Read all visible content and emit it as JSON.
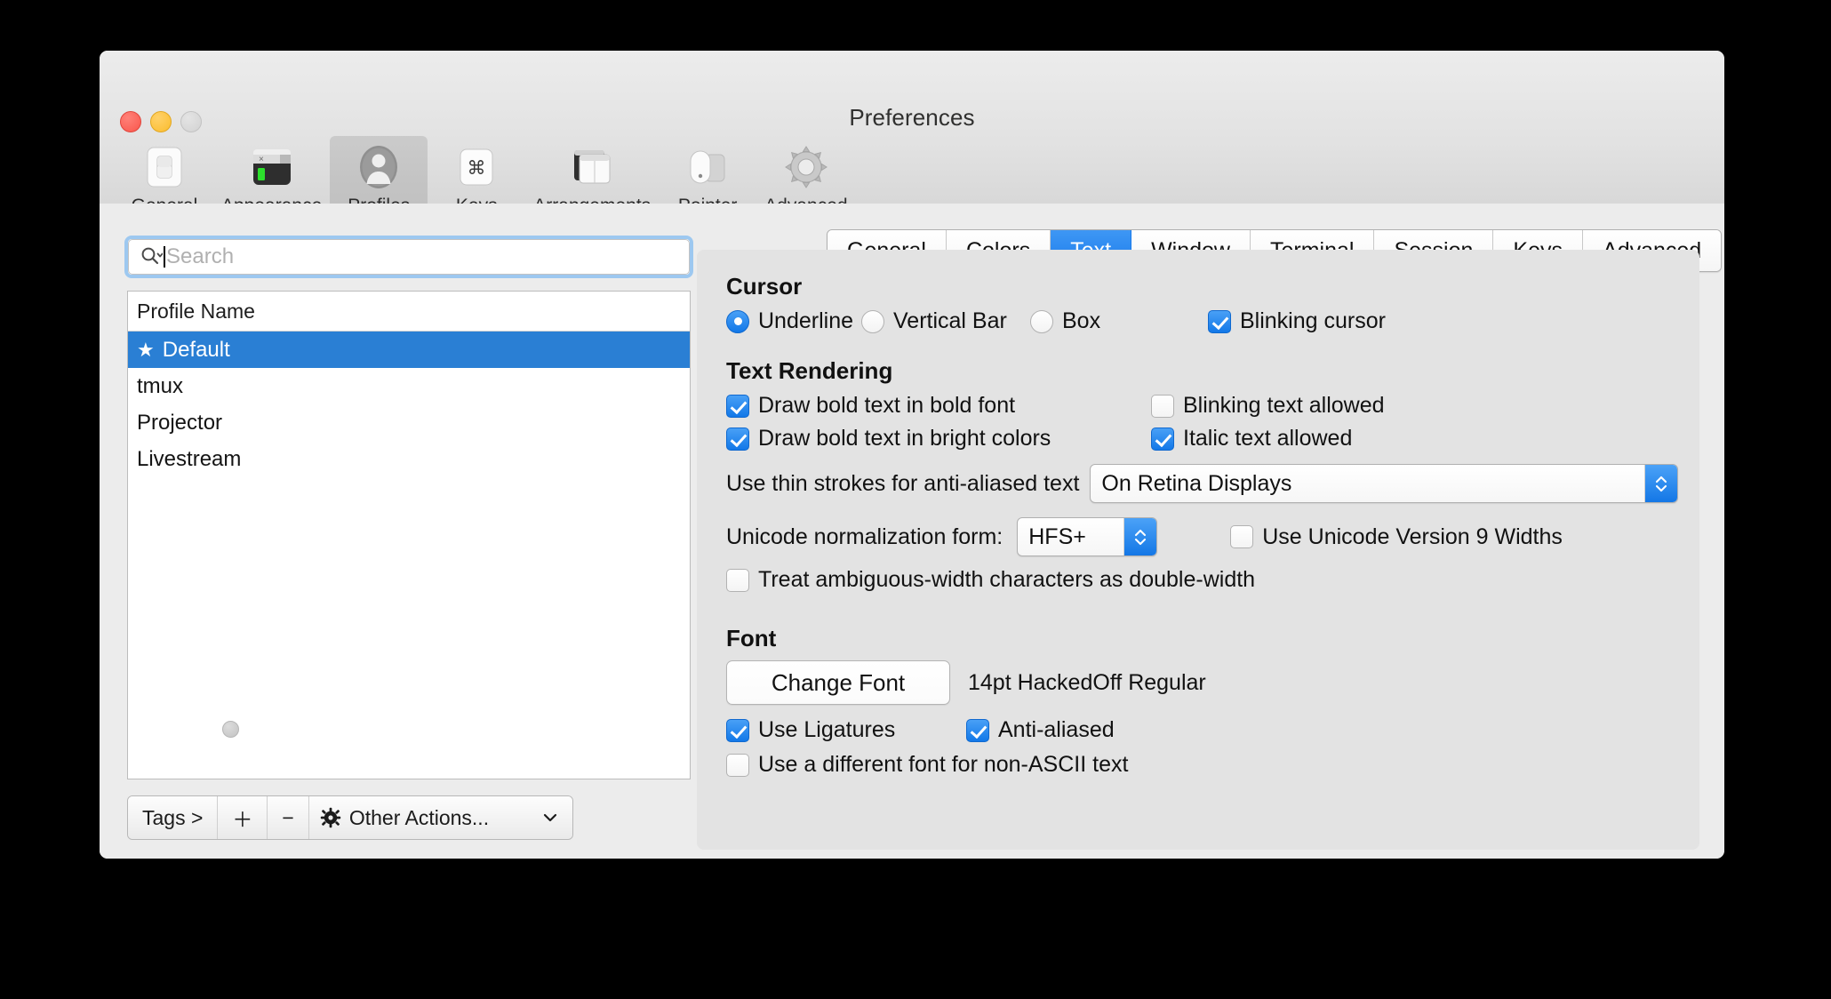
{
  "window": {
    "title": "Preferences",
    "traffic_lights": [
      "close-button",
      "minimize-button",
      "zoom-button"
    ]
  },
  "toolbar": {
    "items": [
      {
        "label": "General",
        "icon": "general-switch-icon",
        "selected": false
      },
      {
        "label": "Appearance",
        "icon": "appearance-terminal-icon",
        "selected": false
      },
      {
        "label": "Profiles",
        "icon": "profiles-person-icon",
        "selected": true
      },
      {
        "label": "Keys",
        "icon": "keys-command-key-icon",
        "selected": false
      },
      {
        "label": "Arrangements",
        "icon": "arrangements-windows-icon",
        "selected": false
      },
      {
        "label": "Pointer",
        "icon": "pointer-mouse-icon",
        "selected": false
      },
      {
        "label": "Advanced",
        "icon": "advanced-gear-icon",
        "selected": false
      }
    ]
  },
  "sidebar": {
    "search": {
      "value": "",
      "placeholder": "Search",
      "icon": "search-magnifier-icon",
      "focused": true
    },
    "list": {
      "column_header": "Profile Name",
      "rows": [
        {
          "name": "Default",
          "star": "★",
          "selected": true
        },
        {
          "name": "tmux",
          "star": "",
          "selected": false
        },
        {
          "name": "Projector",
          "star": "",
          "selected": false
        },
        {
          "name": "Livestream",
          "star": "",
          "selected": false
        }
      ]
    },
    "actions": {
      "tags_label": "Tags >",
      "add_label": "＋",
      "remove_label": "−",
      "other_actions_label": "Other Actions...",
      "other_actions_icon": "gear-icon",
      "chevron_icon": "chevron-down-icon"
    }
  },
  "main": {
    "tabs": [
      {
        "label": "General",
        "active": false
      },
      {
        "label": "Colors",
        "active": false
      },
      {
        "label": "Text",
        "active": true
      },
      {
        "label": "Window",
        "active": false
      },
      {
        "label": "Terminal",
        "active": false
      },
      {
        "label": "Session",
        "active": false
      },
      {
        "label": "Keys",
        "active": false
      },
      {
        "label": "Advanced",
        "active": false
      }
    ],
    "cursor": {
      "heading": "Cursor",
      "style_options": [
        {
          "label": "Underline",
          "selected": true
        },
        {
          "label": "Vertical Bar",
          "selected": false
        },
        {
          "label": "Box",
          "selected": false
        }
      ],
      "blinking_cursor": {
        "label": "Blinking cursor",
        "checked": true
      }
    },
    "text_rendering": {
      "heading": "Text Rendering",
      "checkboxes_left": [
        {
          "label": "Draw bold text in bold font",
          "checked": true
        },
        {
          "label": "Draw bold text in bright colors",
          "checked": true
        }
      ],
      "checkboxes_right": [
        {
          "label": "Blinking text allowed",
          "checked": false
        },
        {
          "label": "Italic text allowed",
          "checked": true
        }
      ],
      "thin_strokes": {
        "label": "Use thin strokes for anti-aliased text",
        "value": "On Retina Displays"
      },
      "unicode_normalization": {
        "label": "Unicode normalization form:",
        "value": "HFS+"
      },
      "unicode_v9": {
        "label": "Use Unicode Version 9 Widths",
        "checked": false
      },
      "ambiguous_width": {
        "label": "Treat ambiguous-width characters as double-width",
        "checked": false
      }
    },
    "font": {
      "heading": "Font",
      "change_font_button": "Change Font",
      "current_font": "14pt HackedOff Regular",
      "use_ligatures": {
        "label": "Use Ligatures",
        "checked": true
      },
      "anti_aliased": {
        "label": "Anti-aliased",
        "checked": true
      },
      "non_ascii_font": {
        "label": "Use a different font for non-ASCII text",
        "checked": false
      }
    }
  },
  "colors": {
    "accent": "#1a7bec",
    "selection": "#2a7fd4",
    "window_bg": "#ececec",
    "panel_bg": "#e3e3e3"
  }
}
